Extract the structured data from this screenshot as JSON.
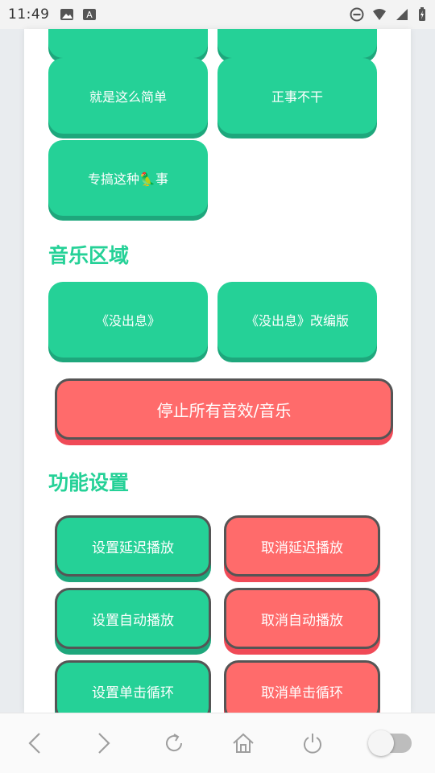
{
  "status_bar": {
    "time": "11:49",
    "icons_left": [
      "image-icon",
      "font-icon"
    ],
    "icons_right": [
      "dnd-icon",
      "wifi-icon",
      "signal-icon",
      "battery-icon"
    ]
  },
  "sound_buttons": [
    {
      "label": ""
    },
    {
      "label": ""
    },
    {
      "label": "就是这么简单"
    },
    {
      "label": "正事不干"
    },
    {
      "label": "专搞这种🦜事"
    }
  ],
  "music_section": {
    "title": "音乐区域",
    "buttons": [
      {
        "label": "《没出息》"
      },
      {
        "label": "《没出息》改编版"
      }
    ]
  },
  "stop_button": {
    "label": "停止所有音效/音乐"
  },
  "function_section": {
    "title": "功能设置",
    "buttons": [
      {
        "label": "设置延迟播放",
        "color": "#25d197"
      },
      {
        "label": "取消延迟播放",
        "color": "#ff6b6b"
      },
      {
        "label": "设置自动播放",
        "color": "#25d197"
      },
      {
        "label": "取消自动播放",
        "color": "#ff6b6b"
      },
      {
        "label": "设置单击循环",
        "color": "#25d197"
      },
      {
        "label": "取消单击循环",
        "color": "#ff6b6b"
      }
    ]
  },
  "colors": {
    "green": "#25d197",
    "red": "#ff6b6b"
  },
  "bottom_nav": {
    "items": [
      "back-icon",
      "forward-icon",
      "refresh-icon",
      "home-icon",
      "power-icon",
      "toggle-switch"
    ]
  }
}
